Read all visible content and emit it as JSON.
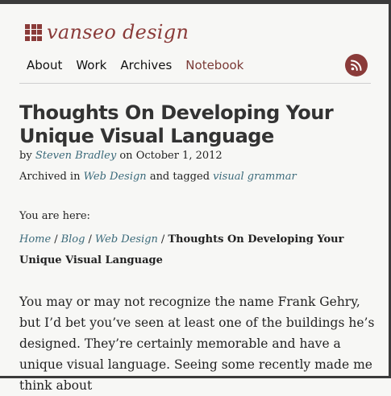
{
  "site": {
    "logo_text": "vanseo design"
  },
  "nav": {
    "items": [
      {
        "label": "About"
      },
      {
        "label": "Work"
      },
      {
        "label": "Archives"
      },
      {
        "label": "Notebook",
        "active": true
      }
    ]
  },
  "rss": {
    "icon": "rss-icon"
  },
  "post": {
    "title": "Thoughts On Developing Your Unique Visual Language",
    "byline_prefix": "by",
    "author": "Steven Bradley",
    "date_prefix": "on",
    "date": "October 1, 2012",
    "archived_prefix": "Archived in",
    "category": "Web Design",
    "tagged_prefix": "and tagged",
    "tag": "visual grammar"
  },
  "breadcrumb": {
    "label": "You are here:",
    "items": [
      "Home",
      "Blog",
      "Web Design"
    ],
    "separator": "/",
    "current": "Thoughts On Developing Your Unique Visual Language"
  },
  "body": {
    "paragraph": "You may or may not recognize the name Frank Gehry, but I’d bet you’ve seen at least one of the buildings he’s designed. They’re certainly memorable and have a unique visual language. Seeing some recently made me think about"
  },
  "colors": {
    "brand": "#8a3b39",
    "link": "#3b6a7a",
    "background": "#f7f7f5"
  }
}
